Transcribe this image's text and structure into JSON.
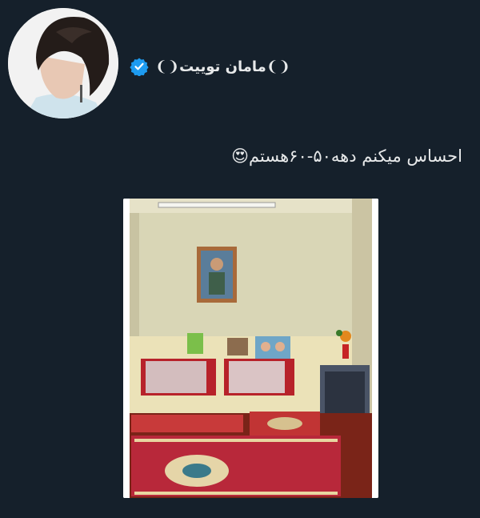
{
  "profile": {
    "display_name": "❨‌❩مامان توییت❨‌❩",
    "verified_icon": "verified-badge-icon",
    "accent": "#1d9bf0"
  },
  "tweet": {
    "text": "احساس میکنم دهه۵۰-۶۰هستم😍"
  },
  "media": {
    "description_icon": "room-photo"
  },
  "colors": {
    "background": "#15202b",
    "text": "#e7e9ea"
  }
}
